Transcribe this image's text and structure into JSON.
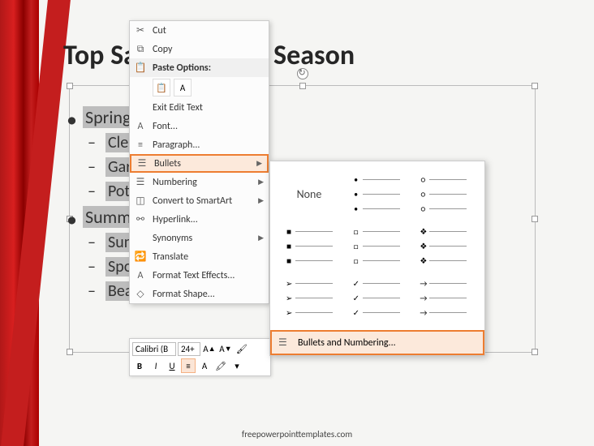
{
  "title": "Top Sales for Each Season",
  "list": {
    "spring": {
      "label": "Spring",
      "items": [
        "Cleaning",
        "Gardening",
        "Pottery"
      ]
    },
    "summer": {
      "label": "Summer",
      "items": [
        "Sunscreen",
        "Sports",
        "Beach"
      ]
    }
  },
  "context_menu": {
    "cut": "Cut",
    "copy": "Copy",
    "paste_options": "Paste Options:",
    "exit_edit": "Exit Edit Text",
    "font": "Font...",
    "paragraph": "Paragraph...",
    "bullets": "Bullets",
    "numbering": "Numbering",
    "smartart": "Convert to SmartArt",
    "hyperlink": "Hyperlink...",
    "synonyms": "Synonyms",
    "translate": "Translate",
    "text_effects": "Format Text Effects...",
    "shape": "Format Shape..."
  },
  "bullets_flyout": {
    "none": "None",
    "footer": "Bullets and Numbering...",
    "styles": [
      "•",
      "○",
      "■",
      "□",
      "❖",
      "➢",
      "✓",
      "→"
    ]
  },
  "mini_toolbar": {
    "font": "Calibri (B",
    "size": "24+",
    "bold": "B",
    "italic": "I",
    "underline": "U"
  },
  "watermark": "freepowerpointtemplates.com"
}
